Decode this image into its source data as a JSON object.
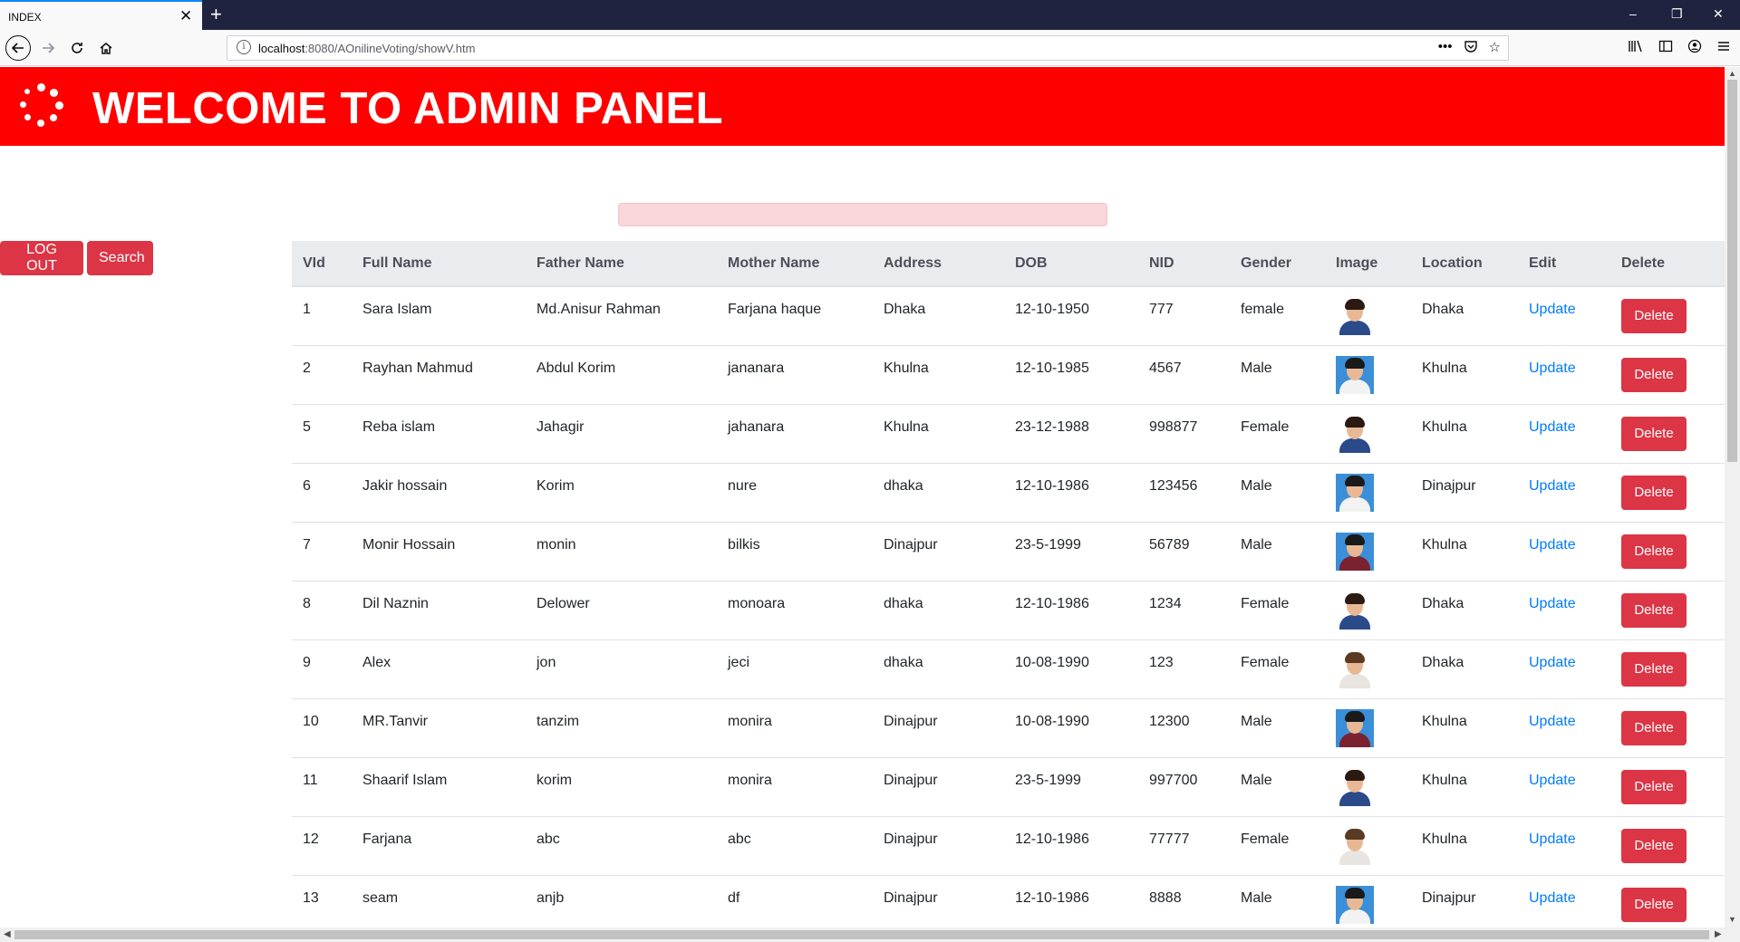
{
  "browser": {
    "tab_title": "INDEX",
    "tab_close": "✕",
    "new_tab": "+",
    "url_host": "localhost",
    "url_rest": ":8080/AOnilineVoting/showV.htm",
    "win_min": "–",
    "win_restore": "❐",
    "win_close": "✕"
  },
  "header": {
    "title": "WELCOME TO ADMIN PANEL"
  },
  "search": {
    "placeholder": ""
  },
  "buttons": {
    "logout": "LOG OUT",
    "search": "Search"
  },
  "table": {
    "columns": [
      "VId",
      "Full Name",
      "Father Name",
      "Mother Name",
      "Address",
      "DOB",
      "NID",
      "Gender",
      "Image",
      "Location",
      "Edit",
      "Delete"
    ],
    "edit_label": "Update",
    "delete_label": "Delete",
    "rows": [
      {
        "vid": "1",
        "full_name": "Sara Islam",
        "father": "Md.Anisur Rahman",
        "mother": "Farjana haque",
        "address": "Dhaka",
        "dob": "12-10-1950",
        "nid": "777",
        "gender": "female",
        "image": "female-portrait-blue",
        "location": "Dhaka"
      },
      {
        "vid": "2",
        "full_name": "Rayhan Mahmud",
        "father": "Abdul Korim",
        "mother": "jananara",
        "address": "Khulna",
        "dob": "12-10-1985",
        "nid": "4567",
        "gender": "Male",
        "image": "male-portrait-white",
        "location": "Khulna"
      },
      {
        "vid": "5",
        "full_name": "Reba islam",
        "father": "Jahagir",
        "mother": "jahanara",
        "address": "Khulna",
        "dob": "23-12-1988",
        "nid": "998877",
        "gender": "Female",
        "image": "female-portrait-blue",
        "location": "Khulna"
      },
      {
        "vid": "6",
        "full_name": "Jakir hossain",
        "father": "Korim",
        "mother": "nure",
        "address": "dhaka",
        "dob": "12-10-1986",
        "nid": "123456",
        "gender": "Male",
        "image": "male-portrait-white",
        "location": "Dinajpur"
      },
      {
        "vid": "7",
        "full_name": "Monir Hossain",
        "father": "monin",
        "mother": "bilkis",
        "address": "Dinajpur",
        "dob": "23-5-1999",
        "nid": "56789",
        "gender": "Male",
        "image": "male-portrait-maroon",
        "location": "Khulna"
      },
      {
        "vid": "8",
        "full_name": "Dil Naznin",
        "father": "Delower",
        "mother": "monoara",
        "address": "dhaka",
        "dob": "12-10-1986",
        "nid": "1234",
        "gender": "Female",
        "image": "female-portrait-blue",
        "location": "Dhaka"
      },
      {
        "vid": "9",
        "full_name": "Alex",
        "father": "jon",
        "mother": "jeci",
        "address": "dhaka",
        "dob": "10-08-1990",
        "nid": "123",
        "gender": "Female",
        "image": "female-portrait-white",
        "location": "Dhaka"
      },
      {
        "vid": "10",
        "full_name": "MR.Tanvir",
        "father": "tanzim",
        "mother": "monira",
        "address": "Dinajpur",
        "dob": "10-08-1990",
        "nid": "12300",
        "gender": "Male",
        "image": "male-portrait-maroon",
        "location": "Khulna"
      },
      {
        "vid": "11",
        "full_name": "Shaarif Islam",
        "father": "korim",
        "mother": "monira",
        "address": "Dinajpur",
        "dob": "23-5-1999",
        "nid": "997700",
        "gender": "Male",
        "image": "female-portrait-blue",
        "location": "Khulna"
      },
      {
        "vid": "12",
        "full_name": "Farjana",
        "father": "abc",
        "mother": "abc",
        "address": "Dinajpur",
        "dob": "12-10-1986",
        "nid": "77777",
        "gender": "Female",
        "image": "female-portrait-white",
        "location": "Khulna"
      },
      {
        "vid": "13",
        "full_name": "seam",
        "father": "anjb",
        "mother": "df",
        "address": "Dinajpur",
        "dob": "12-10-1986",
        "nid": "8888",
        "gender": "Male",
        "image": "male-portrait-white",
        "location": "Dinajpur"
      }
    ]
  },
  "colors": {
    "header_bg": "#ff0000",
    "danger": "#dc3545",
    "link": "#007bff",
    "table_head_bg": "#e9ecef",
    "search_bg": "#f8d7da"
  }
}
